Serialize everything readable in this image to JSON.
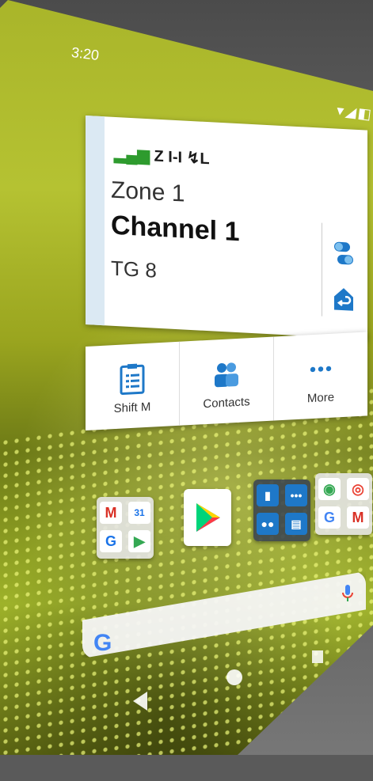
{
  "status_bar": {
    "time": "3:20",
    "icons_glyph": "▾◢◧"
  },
  "radio_widget": {
    "icons_text": "Z I-I ↯L",
    "signal_glyph": "▂▄▆",
    "zone": "Zone 1",
    "channel": "Channel 1",
    "talkgroup": "TG 8"
  },
  "shortcuts": [
    {
      "label": "Shift M",
      "icon": "clipboard-list-icon"
    },
    {
      "label": "Contacts",
      "icon": "contacts-icon"
    },
    {
      "label": "More",
      "icon": "more-horizontal-icon"
    }
  ],
  "apps": {
    "google_folder_1": [
      "gmail-icon",
      "calendar-icon",
      "google-icon",
      "play-icon"
    ],
    "play_store": "play-store-icon",
    "radio_folder": [
      "radio-icon",
      "more-icon",
      "contacts-icon",
      "messages-icon"
    ],
    "google_folder_2": [
      "maps-icon",
      "chrome-icon",
      "google-icon",
      "gmail-icon"
    ]
  },
  "google_folder_1_cells": {
    "gmail": "M",
    "calendar": "31",
    "google": "G",
    "play": "▶"
  },
  "google_folder_2_cells": {
    "maps": "◉",
    "chrome": "◎",
    "google": "G",
    "gmail": "M"
  },
  "search": {
    "logo_letter": "G"
  },
  "colors": {
    "brand_blue": "#4285F4",
    "widget_stripe": "#dbe9f3",
    "icon_blue": "#1e78c8"
  }
}
